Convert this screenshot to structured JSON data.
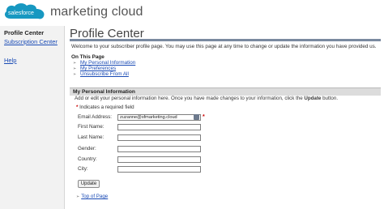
{
  "header": {
    "logo_text": "salesforce",
    "brand_text": "marketing cloud"
  },
  "sidebar": {
    "title": "Profile Center",
    "items": [
      {
        "label": "Subscription Center"
      },
      {
        "label": "Help"
      }
    ]
  },
  "main": {
    "title": "Profile Center",
    "welcome": "Welcome to your subscriber profile page. You may use this page at any time to change or update the information you have provided us.",
    "on_this_page_label": "On This Page",
    "nav_links": [
      {
        "label": "My Personal Information"
      },
      {
        "label": "My Preferences"
      },
      {
        "label": "Unsubscribe From All"
      }
    ]
  },
  "personal_info": {
    "title": "My Personal Information",
    "description_prefix": "Add or edit your personal information here. Once you have made changes to your information, click the ",
    "description_bold": "Update",
    "description_suffix": " button.",
    "required_note": "Indicates a required field",
    "fields": [
      {
        "label": "Email Address:",
        "value": "zuzanne@sfmarketing.cloud",
        "required": true
      },
      {
        "label": "First Name:",
        "value": ""
      },
      {
        "label": "Last Name:",
        "value": ""
      },
      {
        "label": "Gender:",
        "value": ""
      },
      {
        "label": "Country:",
        "value": ""
      },
      {
        "label": "City:",
        "value": ""
      }
    ],
    "update_label": "Update",
    "top_link": "Top of Page"
  },
  "colors": {
    "logo_blue": "#1798c1",
    "link_blue": "#1a4bb5",
    "required_red": "#cc0000",
    "section_bar": "#dcdcdc"
  },
  "icons": [
    "salesforce-logo-cloud",
    "arrow-right-icon",
    "autofill-key-icon"
  ]
}
